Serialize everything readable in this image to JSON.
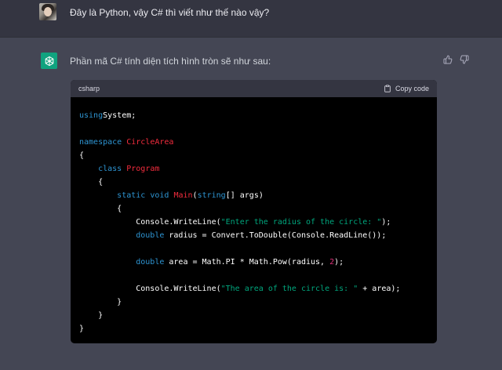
{
  "user": {
    "message": "Đây là Python, vậy C# thì viết như thế nào vậy?"
  },
  "assistant": {
    "intro": "Phần mã C# tính diện tích hình tròn sẽ như sau:"
  },
  "code_block": {
    "language": "csharp",
    "copy_label": "Copy code",
    "lines": [
      [
        [
          "kw",
          "using"
        ],
        [
          "",
          "System;"
        ]
      ],
      [],
      [
        [
          "kw",
          "namespace"
        ],
        [
          "",
          " "
        ],
        [
          "ty",
          "CircleArea"
        ]
      ],
      [
        [
          "",
          "{"
        ]
      ],
      [
        [
          "",
          "    "
        ],
        [
          "kw",
          "class"
        ],
        [
          "",
          " "
        ],
        [
          "ty",
          "Program"
        ]
      ],
      [
        [
          "",
          "    {"
        ]
      ],
      [
        [
          "",
          "        "
        ],
        [
          "kw",
          "static"
        ],
        [
          "",
          " "
        ],
        [
          "kw",
          "void"
        ],
        [
          "",
          " "
        ],
        [
          "ty",
          "Main"
        ],
        [
          "",
          "("
        ],
        [
          "kw",
          "string"
        ],
        [
          "",
          "[] args)"
        ]
      ],
      [
        [
          "",
          "        {"
        ]
      ],
      [
        [
          "",
          "            Console.WriteLine("
        ],
        [
          "str",
          "\"Enter the radius of the circle: \""
        ],
        [
          "",
          ");"
        ]
      ],
      [
        [
          "",
          "            "
        ],
        [
          "kw",
          "double"
        ],
        [
          "",
          " radius = Convert.ToDouble(Console.ReadLine());"
        ]
      ],
      [],
      [
        [
          "",
          "            "
        ],
        [
          "kw",
          "double"
        ],
        [
          "",
          " area = Math.PI * Math.Pow(radius, "
        ],
        [
          "num",
          "2"
        ],
        [
          "",
          ");"
        ]
      ],
      [],
      [
        [
          "",
          "            Console.WriteLine("
        ],
        [
          "str",
          "\"The area of the circle is: \""
        ],
        [
          "",
          " + area);"
        ]
      ],
      [
        [
          "",
          "        }"
        ]
      ],
      [
        [
          "",
          "    }"
        ]
      ],
      [
        [
          "",
          "}"
        ]
      ]
    ]
  },
  "colors": {
    "background": "#444654",
    "user_row": "#343541",
    "bot_avatar": "#10a37f",
    "keyword": "#2e95d3",
    "type": "#f22c3d",
    "string": "#00a67d",
    "number": "#df3079"
  },
  "icons": {
    "assistant_avatar": "openai-logo-icon",
    "copy": "clipboard-icon",
    "like": "thumbs-up-icon",
    "dislike": "thumbs-down-icon"
  }
}
